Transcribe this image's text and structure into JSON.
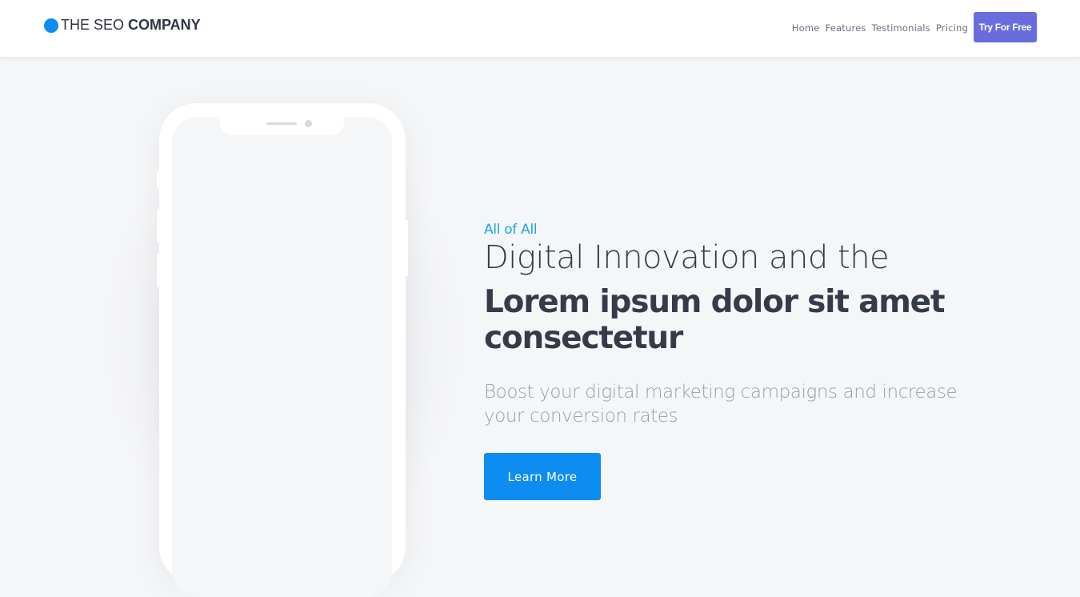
{
  "header": {
    "logo_light": "THE SEO",
    "logo_bold": "COMPANY",
    "nav": [
      "Home",
      "Features",
      "Testimonials",
      "Pricing"
    ],
    "cta_label": "Try For Free"
  },
  "hero": {
    "eyebrow": "All of All",
    "headline_light": "Digital Innovation and the",
    "headline_bold": "Lorem ipsum dolor sit amet consectetur",
    "subtitle": "Boost your digital marketing campaigns and increase your conversion rates",
    "button_label": "Learn More"
  },
  "colors": {
    "brand_blue": "#0d8cf1",
    "cta_purple": "#6a6cde",
    "eyebrow_cyan": "#1ea6e0",
    "heading_dark": "#363b4a",
    "subtitle_gray": "#9a9ea8",
    "page_background": "#f5f6f8"
  }
}
